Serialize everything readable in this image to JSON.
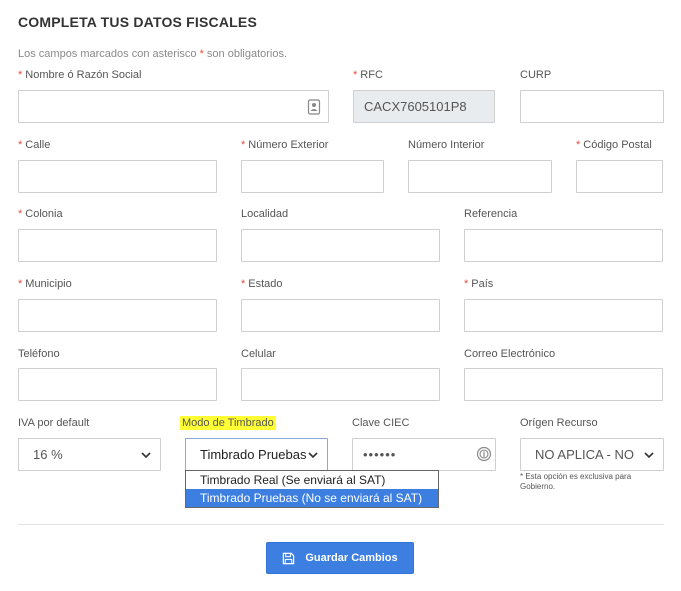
{
  "title": "COMPLETA TUS DATOS FISCALES",
  "note": {
    "before": "Los campos marcados con asterisco ",
    "star": "*",
    "after": " son obligatorios."
  },
  "fields": {
    "nombre": {
      "label": "Nombre ó Razón Social",
      "value": ""
    },
    "rfc": {
      "label": "RFC",
      "value": "CACX7605101P8"
    },
    "curp": {
      "label": "CURP",
      "value": ""
    },
    "calle": {
      "label": "Calle",
      "value": ""
    },
    "num_ext": {
      "label": "Número Exterior",
      "value": ""
    },
    "num_int": {
      "label": "Número Interior",
      "value": ""
    },
    "cp": {
      "label": "Código Postal",
      "value": ""
    },
    "colonia": {
      "label": "Colonia",
      "value": ""
    },
    "localidad": {
      "label": "Localidad",
      "value": ""
    },
    "referencia": {
      "label": "Referencia",
      "value": ""
    },
    "municipio": {
      "label": "Municipio",
      "value": ""
    },
    "estado": {
      "label": "Estado",
      "value": ""
    },
    "pais": {
      "label": "País",
      "value": ""
    },
    "telefono": {
      "label": "Teléfono",
      "value": ""
    },
    "celular": {
      "label": "Celular",
      "value": ""
    },
    "correo": {
      "label": "Correo Electrónico",
      "value": ""
    },
    "iva": {
      "label": "IVA por default",
      "value": "16 %"
    },
    "modo": {
      "label": "Modo de Timbrado",
      "value": "Timbrado Pruebas"
    },
    "ciec": {
      "label": "Clave CIEC",
      "value": "••••••"
    },
    "origen": {
      "label": "Orígen Recurso",
      "value": "NO APLICA - NO"
    }
  },
  "required_star": "*",
  "modo_options": [
    "Timbrado Real (Se enviará al SAT)",
    "Timbrado Pruebas (No se enviará al SAT)"
  ],
  "origen_hint": "* Esta opción es exclusiva para Gobierno.",
  "save_button": "Guardar Cambios",
  "colors": {
    "accent": "#3d7fe0",
    "required": "#e74c3c",
    "highlight": "#ffff33"
  }
}
